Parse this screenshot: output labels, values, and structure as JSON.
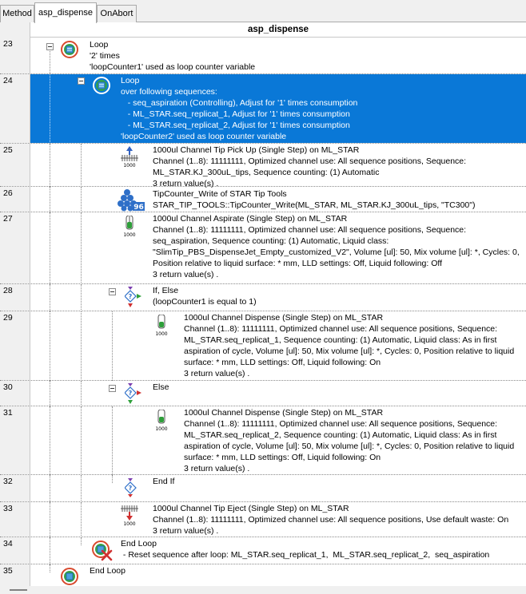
{
  "tabs": [
    {
      "label": "Method"
    },
    {
      "label": "asp_dispense",
      "active": true
    },
    {
      "label": "OnAbort"
    }
  ],
  "grid_title": "asp_dispense",
  "colors": {
    "selection": "#0a78d7",
    "gutter": "#f0f0f0"
  },
  "rows": [
    {
      "num": "23",
      "lines": [
        "Loop",
        "'2' times",
        "'loopCounter1' used as loop counter variable"
      ],
      "icon": "loop-icon"
    },
    {
      "num": "24",
      "lines": [
        "Loop",
        "over following sequences:",
        "   - seq_aspiration (Controlling), Adjust for '1' times consumption",
        "   - ML_STAR.seq_replicat_1, Adjust for '1' times consumption",
        "   - ML_STAR.seq_replicat_2, Adjust for '1' times consumption",
        "'loopCounter2' used as loop counter variable"
      ],
      "icon": "loop-icon",
      "selected": true
    },
    {
      "num": "25",
      "lines": [
        "1000ul Channel Tip Pick Up (Single Step) on ML_STAR",
        "Channel (1..8): 11111111, Optimized channel use: All sequence positions, Sequence:",
        "ML_STAR.KJ_300uL_tips, Sequence counting: (1) Automatic",
        "3 return value(s) ."
      ],
      "icon": "tip-pickup-icon",
      "icon_label": "1000"
    },
    {
      "num": "26",
      "lines": [
        "TipCounter_Write of STAR Tip Tools",
        "STAR_TIP_TOOLS::TipCounter_Write(ML_STAR, ML_STAR.KJ_300uL_tips, \"TC300\")"
      ],
      "icon": "tip-counter-icon",
      "icon_label": "96"
    },
    {
      "num": "27",
      "lines": [
        "1000ul Channel Aspirate (Single Step) on ML_STAR",
        "Channel (1..8): 11111111, Optimized channel use: All sequence positions, Sequence:",
        "seq_aspiration, Sequence counting: (1) Automatic, Liquid class:",
        "\"SlimTip_PBS_DispenseJet_Empty_customized_V2\", Volume [ul]: 50, Mix volume [ul]: *, Cycles: 0,",
        "Position relative to liquid surface: * mm, LLD settings: Off, Liquid following: Off",
        "3 return value(s) ."
      ],
      "icon": "aspirate-icon",
      "icon_label": "1000"
    },
    {
      "num": "28",
      "lines": [
        "If, Else",
        "(loopCounter1 is equal to 1)"
      ],
      "icon": "if-else-icon"
    },
    {
      "num": "29",
      "lines": [
        "1000ul Channel Dispense (Single Step) on ML_STAR",
        "Channel (1..8): 11111111, Optimized channel use: All sequence positions, Sequence:",
        "ML_STAR.seq_replicat_1, Sequence counting: (1) Automatic, Liquid class: As in first",
        "aspiration of cycle, Volume [ul]: 50, Mix volume [ul]: *, Cycles: 0, Position relative to liquid",
        "surface: * mm, LLD settings: Off, Liquid following: On",
        "3 return value(s) ."
      ],
      "icon": "dispense-icon",
      "icon_label": "1000"
    },
    {
      "num": "30",
      "lines": [
        "Else"
      ],
      "icon": "else-icon"
    },
    {
      "num": "31",
      "lines": [
        "1000ul Channel Dispense (Single Step) on ML_STAR",
        "Channel (1..8): 11111111, Optimized channel use: All sequence positions, Sequence:",
        "ML_STAR.seq_replicat_2, Sequence counting: (1) Automatic, Liquid class: As in first",
        "aspiration of cycle, Volume [ul]: 50, Mix volume [ul]: *, Cycles: 0, Position relative to liquid",
        "surface: * mm, LLD settings: Off, Liquid following: On",
        "3 return value(s) ."
      ],
      "icon": "dispense-icon",
      "icon_label": "1000"
    },
    {
      "num": "32",
      "lines": [
        "End If"
      ],
      "icon": "end-if-icon"
    },
    {
      "num": "33",
      "lines": [
        "1000ul Channel Tip Eject (Single Step) on ML_STAR",
        "Channel (1..8): 11111111, Optimized channel use: All sequence positions, Use default waste: On",
        "3 return value(s) ."
      ],
      "icon": "tip-eject-icon",
      "icon_label": "1000"
    },
    {
      "num": "34",
      "lines": [
        "End Loop",
        " - Reset sequence after loop: ML_STAR.seq_replicat_1,  ML_STAR.seq_replicat_2,  seq_aspiration"
      ],
      "icon": "end-loop-icon"
    },
    {
      "num": "35",
      "lines": [
        "End Loop"
      ],
      "icon": "end-loop-icon"
    }
  ]
}
